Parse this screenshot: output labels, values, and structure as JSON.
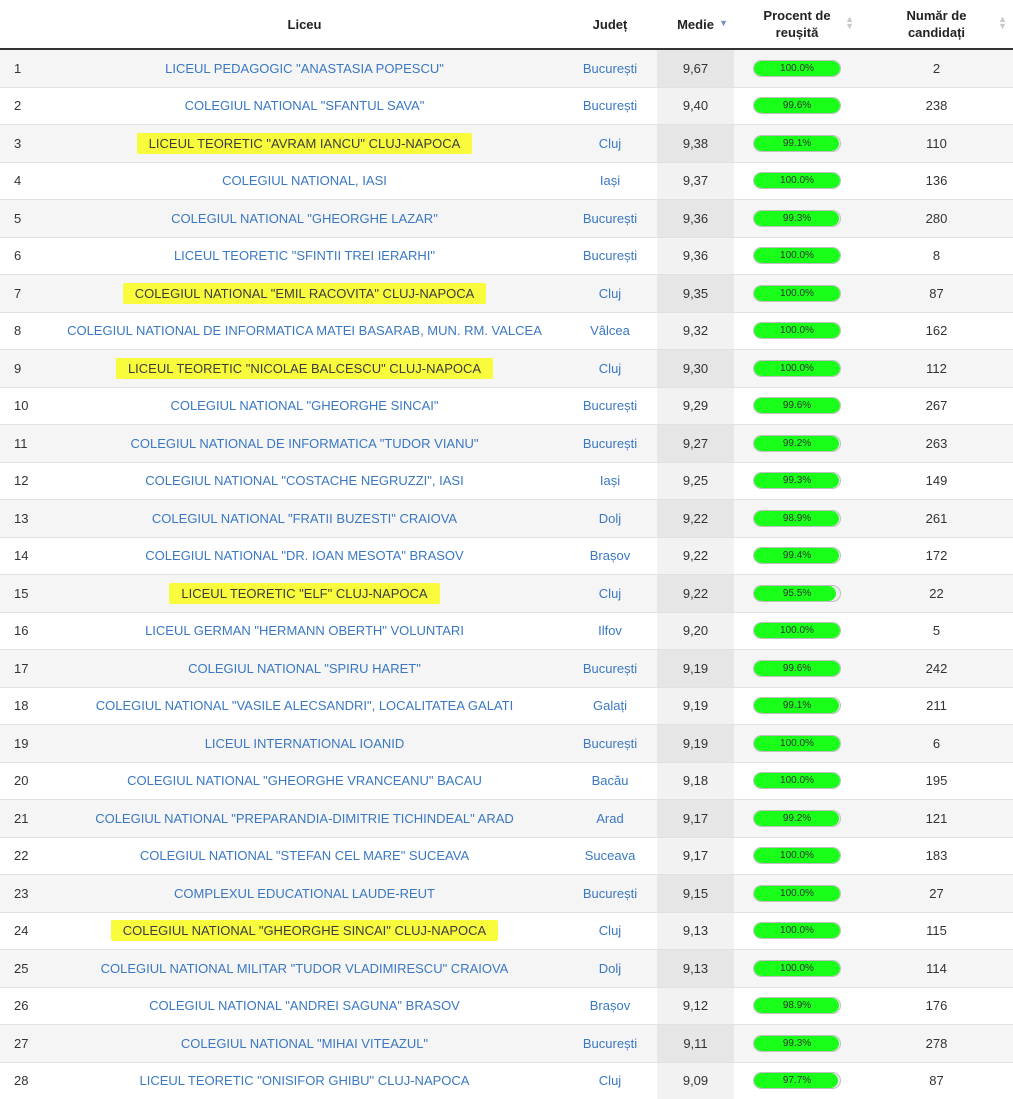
{
  "headers": {
    "liceu": "Liceu",
    "judet": "Județ",
    "medie": "Medie",
    "procent_line1": "Procent de",
    "procent_line2": "reușită",
    "numar_line1": "Număr de",
    "numar_line2": "candidați"
  },
  "rows": [
    {
      "idx": "1",
      "school": "LICEUL PEDAGOGIC \"ANASTASIA POPESCU\"",
      "county": "București",
      "avg": "9,67",
      "pct_label": "100.0%",
      "pct": 100.0,
      "count": "2",
      "highlighted": false
    },
    {
      "idx": "2",
      "school": "COLEGIUL NATIONAL \"SFANTUL SAVA\"",
      "county": "București",
      "avg": "9,40",
      "pct_label": "99.6%",
      "pct": 99.6,
      "count": "238",
      "highlighted": false
    },
    {
      "idx": "3",
      "school": "LICEUL TEORETIC \"AVRAM IANCU\" CLUJ-NAPOCA",
      "county": "Cluj",
      "avg": "9,38",
      "pct_label": "99.1%",
      "pct": 99.1,
      "count": "110",
      "highlighted": true
    },
    {
      "idx": "4",
      "school": "COLEGIUL NATIONAL, IASI",
      "county": "Iași",
      "avg": "9,37",
      "pct_label": "100.0%",
      "pct": 100.0,
      "count": "136",
      "highlighted": false
    },
    {
      "idx": "5",
      "school": "COLEGIUL NATIONAL \"GHEORGHE LAZAR\"",
      "county": "București",
      "avg": "9,36",
      "pct_label": "99.3%",
      "pct": 99.3,
      "count": "280",
      "highlighted": false
    },
    {
      "idx": "6",
      "school": "LICEUL TEORETIC \"SFINTII TREI IERARHI\"",
      "county": "București",
      "avg": "9,36",
      "pct_label": "100.0%",
      "pct": 100.0,
      "count": "8",
      "highlighted": false
    },
    {
      "idx": "7",
      "school": "COLEGIUL NATIONAL \"EMIL RACOVITA\" CLUJ-NAPOCA",
      "county": "Cluj",
      "avg": "9,35",
      "pct_label": "100.0%",
      "pct": 100.0,
      "count": "87",
      "highlighted": true
    },
    {
      "idx": "8",
      "school": "COLEGIUL NATIONAL DE INFORMATICA MATEI BASARAB, MUN. RM. VALCEA",
      "county": "Vâlcea",
      "avg": "9,32",
      "pct_label": "100.0%",
      "pct": 100.0,
      "count": "162",
      "highlighted": false
    },
    {
      "idx": "9",
      "school": "LICEUL TEORETIC \"NICOLAE BALCESCU\" CLUJ-NAPOCA",
      "county": "Cluj",
      "avg": "9,30",
      "pct_label": "100.0%",
      "pct": 100.0,
      "count": "112",
      "highlighted": true
    },
    {
      "idx": "10",
      "school": "COLEGIUL NATIONAL \"GHEORGHE SINCAI\"",
      "county": "București",
      "avg": "9,29",
      "pct_label": "99.6%",
      "pct": 99.6,
      "count": "267",
      "highlighted": false
    },
    {
      "idx": "11",
      "school": "COLEGIUL NATIONAL DE INFORMATICA \"TUDOR VIANU\"",
      "county": "București",
      "avg": "9,27",
      "pct_label": "99.2%",
      "pct": 99.2,
      "count": "263",
      "highlighted": false
    },
    {
      "idx": "12",
      "school": "COLEGIUL NATIONAL \"COSTACHE NEGRUZZI\", IASI",
      "county": "Iași",
      "avg": "9,25",
      "pct_label": "99.3%",
      "pct": 99.3,
      "count": "149",
      "highlighted": false
    },
    {
      "idx": "13",
      "school": "COLEGIUL NATIONAL \"FRATII BUZESTI\" CRAIOVA",
      "county": "Dolj",
      "avg": "9,22",
      "pct_label": "98.9%",
      "pct": 98.9,
      "count": "261",
      "highlighted": false
    },
    {
      "idx": "14",
      "school": "COLEGIUL NATIONAL \"DR. IOAN MESOTA\" BRASOV",
      "county": "Brașov",
      "avg": "9,22",
      "pct_label": "99.4%",
      "pct": 99.4,
      "count": "172",
      "highlighted": false
    },
    {
      "idx": "15",
      "school": "LICEUL TEORETIC \"ELF\" CLUJ-NAPOCA",
      "county": "Cluj",
      "avg": "9,22",
      "pct_label": "95.5%",
      "pct": 95.5,
      "count": "22",
      "highlighted": true
    },
    {
      "idx": "16",
      "school": "LICEUL GERMAN \"HERMANN OBERTH\" VOLUNTARI",
      "county": "Ilfov",
      "avg": "9,20",
      "pct_label": "100.0%",
      "pct": 100.0,
      "count": "5",
      "highlighted": false
    },
    {
      "idx": "17",
      "school": "COLEGIUL NATIONAL \"SPIRU HARET\"",
      "county": "București",
      "avg": "9,19",
      "pct_label": "99.6%",
      "pct": 99.6,
      "count": "242",
      "highlighted": false
    },
    {
      "idx": "18",
      "school": "COLEGIUL NATIONAL \"VASILE ALECSANDRI\", LOCALITATEA GALATI",
      "county": "Galați",
      "avg": "9,19",
      "pct_label": "99.1%",
      "pct": 99.1,
      "count": "211",
      "highlighted": false
    },
    {
      "idx": "19",
      "school": "LICEUL INTERNATIONAL IOANID",
      "county": "București",
      "avg": "9,19",
      "pct_label": "100.0%",
      "pct": 100.0,
      "count": "6",
      "highlighted": false
    },
    {
      "idx": "20",
      "school": "COLEGIUL NATIONAL \"GHEORGHE VRANCEANU\" BACAU",
      "county": "Bacău",
      "avg": "9,18",
      "pct_label": "100.0%",
      "pct": 100.0,
      "count": "195",
      "highlighted": false
    },
    {
      "idx": "21",
      "school": "COLEGIUL NATIONAL \"PREPARANDIA-DIMITRIE TICHINDEAL\" ARAD",
      "county": "Arad",
      "avg": "9,17",
      "pct_label": "99.2%",
      "pct": 99.2,
      "count": "121",
      "highlighted": false
    },
    {
      "idx": "22",
      "school": "COLEGIUL NATIONAL \"STEFAN CEL MARE\" SUCEAVA",
      "county": "Suceava",
      "avg": "9,17",
      "pct_label": "100.0%",
      "pct": 100.0,
      "count": "183",
      "highlighted": false
    },
    {
      "idx": "23",
      "school": "COMPLEXUL EDUCATIONAL LAUDE-REUT",
      "county": "București",
      "avg": "9,15",
      "pct_label": "100.0%",
      "pct": 100.0,
      "count": "27",
      "highlighted": false
    },
    {
      "idx": "24",
      "school": "COLEGIUL NATIONAL \"GHEORGHE SINCAI\" CLUJ-NAPOCA",
      "county": "Cluj",
      "avg": "9,13",
      "pct_label": "100.0%",
      "pct": 100.0,
      "count": "115",
      "highlighted": true
    },
    {
      "idx": "25",
      "school": "COLEGIUL NATIONAL MILITAR \"TUDOR VLADIMIRESCU\" CRAIOVA",
      "county": "Dolj",
      "avg": "9,13",
      "pct_label": "100.0%",
      "pct": 100.0,
      "count": "114",
      "highlighted": false
    },
    {
      "idx": "26",
      "school": "COLEGIUL NATIONAL \"ANDREI SAGUNA\" BRASOV",
      "county": "Brașov",
      "avg": "9,12",
      "pct_label": "98.9%",
      "pct": 98.9,
      "count": "176",
      "highlighted": false
    },
    {
      "idx": "27",
      "school": "COLEGIUL NATIONAL \"MIHAI VITEAZUL\"",
      "county": "București",
      "avg": "9,11",
      "pct_label": "99.3%",
      "pct": 99.3,
      "count": "278",
      "highlighted": false
    },
    {
      "idx": "28",
      "school": "LICEUL TEORETIC \"ONISIFOR GHIBU\" CLUJ-NAPOCA",
      "county": "Cluj",
      "avg": "9,09",
      "pct_label": "97.7%",
      "pct": 97.7,
      "count": "87",
      "highlighted": false
    }
  ],
  "colors": {
    "link": "#3a78c3",
    "highlight": "#f8fc3c",
    "bar_fill": "#19ff19",
    "sort_active": "#6e8fc7"
  },
  "sort": {
    "column": "medie",
    "direction": "descending"
  }
}
